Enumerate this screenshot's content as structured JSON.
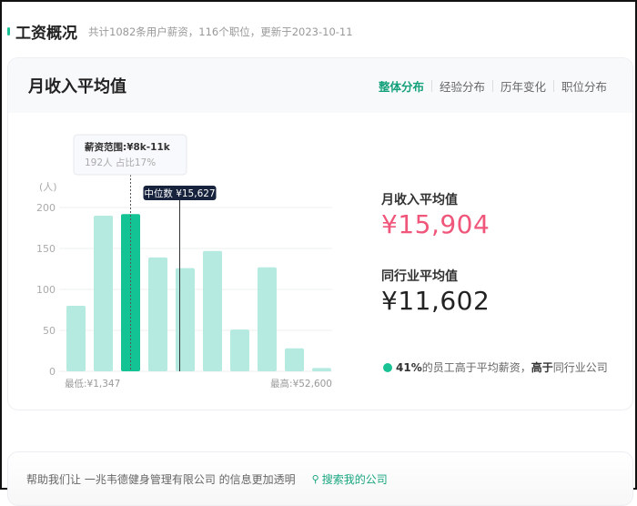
{
  "header": {
    "title": "工资概况",
    "subtitle": "共计1082条用户薪资，116个职位，更新于2023-10-11"
  },
  "card": {
    "title": "月收入平均值",
    "tabs": [
      {
        "label": "整体分布",
        "active": true
      },
      {
        "label": "经验分布"
      },
      {
        "label": "历年变化"
      },
      {
        "label": "职位分布"
      }
    ]
  },
  "chart_data": {
    "type": "bar",
    "ylabel": "(人)",
    "ylim": [
      0,
      200
    ],
    "yticks": [
      0,
      50,
      100,
      150,
      200
    ],
    "values": [
      80,
      190,
      192,
      139,
      126,
      147,
      51,
      127,
      28,
      4
    ],
    "highlight_index": 2,
    "min_label": "最低:¥1,347",
    "max_label": "最高:¥52,600",
    "tooltip": {
      "title": "薪资范围:¥8k-11k",
      "detail": "192人  占比17%"
    },
    "median_label": "中位数 ¥15,627",
    "colors": {
      "bar": "#b4eadf",
      "highlight": "#14c394"
    }
  },
  "stats": {
    "avg_label": "月收入平均值",
    "avg_value": "¥15,904",
    "avg_color": "#f0557a",
    "industry_label": "同行业平均值",
    "industry_value": "¥11,602",
    "note_pct": "41%",
    "note_mid": "的员工高于平均薪资，",
    "note_bold": "高于",
    "note_end": "同行业公司"
  },
  "footer": {
    "text": "帮助我们让 一兆韦德健身管理有限公司 的信息更加透明",
    "search": "搜索我的公司"
  }
}
